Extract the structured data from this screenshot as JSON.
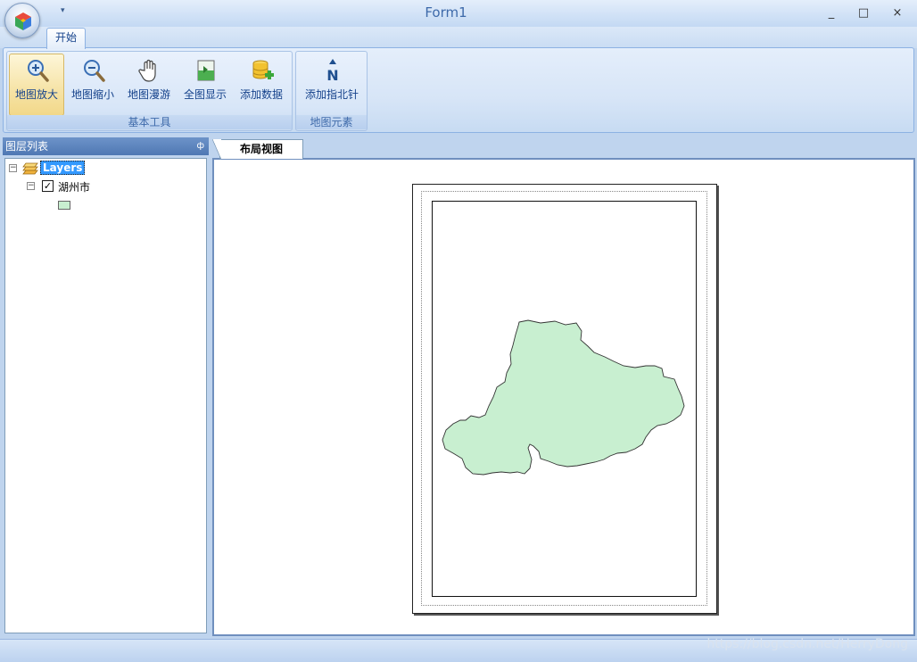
{
  "window": {
    "title": "Form1",
    "minimize_glyph": "_",
    "maximize_glyph": "□",
    "close_glyph": "×",
    "qat_glyph": "▾"
  },
  "ribbon": {
    "tabs": [
      {
        "label": "开始",
        "active": true
      }
    ],
    "groups": [
      {
        "label": "基本工具",
        "buttons": [
          {
            "label": "地图放大",
            "icon": "zoom-in-icon",
            "active": true
          },
          {
            "label": "地图缩小",
            "icon": "zoom-out-icon",
            "active": false
          },
          {
            "label": "地图漫游",
            "icon": "pan-hand-icon",
            "active": false
          },
          {
            "label": "全图显示",
            "icon": "full-extent-icon",
            "active": false
          },
          {
            "label": "添加数据",
            "icon": "add-data-icon",
            "active": false
          }
        ]
      },
      {
        "label": "地图元素",
        "buttons": [
          {
            "label": "添加指北针",
            "icon": "north-arrow-icon",
            "active": false
          }
        ]
      }
    ]
  },
  "layer_panel": {
    "title": "图层列表",
    "pin_glyph": "ф",
    "tree": {
      "root_label": "Layers",
      "layers": [
        {
          "label": "湖州市",
          "checked": true,
          "symbol_color": "#c8efd0"
        }
      ]
    }
  },
  "document": {
    "tabs": [
      {
        "label": "布局视图",
        "active": true
      }
    ]
  },
  "colors": {
    "ribbon_text": "#15428b",
    "map_fill": "#c8efd0",
    "selection": "#3399ff"
  },
  "watermark": "https://blog.csdn.net/HerryDong"
}
